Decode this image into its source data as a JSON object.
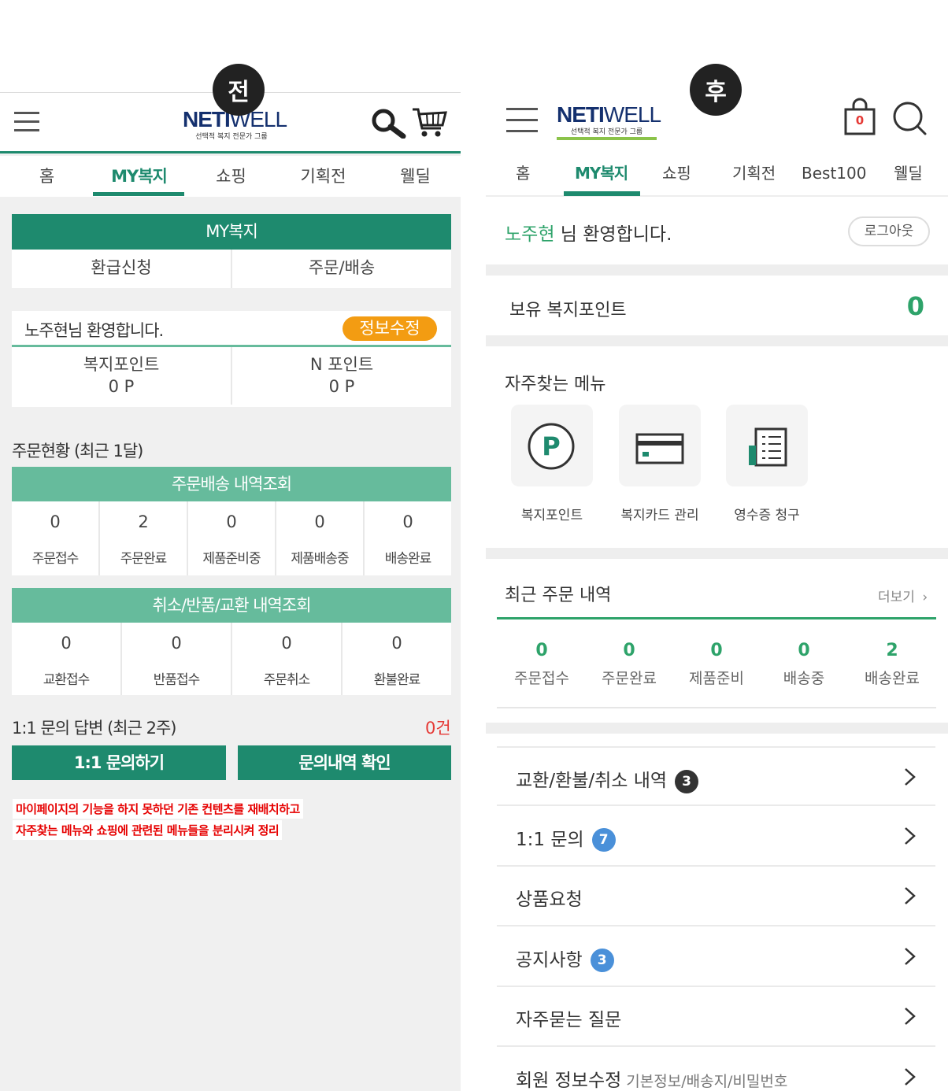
{
  "before": {
    "badge": "전",
    "logo": {
      "main": "NETIWELL",
      "sub": "선택적 복지 전문가 그룹"
    },
    "nav": [
      "홈",
      "MY복지",
      "쇼핑",
      "기획전",
      "웰딜"
    ],
    "my_header": "MY복지",
    "my_tabs": [
      "환급신청",
      "주문/배송"
    ],
    "welcome": "노주현님 환영합니다.",
    "edit_info": "정보수정",
    "points": [
      {
        "label": "복지포인트",
        "value": "0 P"
      },
      {
        "label": "N 포인트",
        "value": "0 P"
      }
    ],
    "order_title": "주문현황 (최근 1달)",
    "order_header": "주문배송 내역조회",
    "order_stats": [
      {
        "value": "0",
        "label": "주문접수"
      },
      {
        "value": "2",
        "label": "주문완료"
      },
      {
        "value": "0",
        "label": "제품준비중"
      },
      {
        "value": "0",
        "label": "제품배송중"
      },
      {
        "value": "0",
        "label": "배송완료"
      }
    ],
    "cancel_header": "취소/반품/교환 내역조회",
    "cancel_stats": [
      {
        "value": "0",
        "label": "교환접수"
      },
      {
        "value": "0",
        "label": "반품접수"
      },
      {
        "value": "0",
        "label": "주문취소"
      },
      {
        "value": "0",
        "label": "환불완료"
      }
    ],
    "qna_title": "1:1 문의 답변 (최근 2주)",
    "qna_count": "0건",
    "btn_inquiry": "1:1 문의하기",
    "btn_history": "문의내역 확인",
    "note_line1": "마이페이지의 기능을 하지 못하던 기존 컨텐츠를 재배치하고",
    "note_line2": "자주찾는 메뉴와 쇼핑에 관련된 메뉴들을 분리시켜 정리"
  },
  "after": {
    "badge": "후",
    "logo": {
      "main": "NETIWELL",
      "sub": "선택적 복지 전문가 그룹"
    },
    "cart_count": "0",
    "nav": [
      "홈",
      "MY복지",
      "쇼핑",
      "기획전",
      "Best100",
      "웰딜"
    ],
    "user_name": "노주현",
    "welcome_suffix": " 님 환영합니다.",
    "logout": "로그아웃",
    "points_label": "보유 복지포인트",
    "points_value": "0",
    "quick_title": "자주찾는 메뉴",
    "quick_menu": [
      {
        "label": "복지포인트",
        "icon": "point-icon"
      },
      {
        "label": "복지카드 관리",
        "icon": "card-icon"
      },
      {
        "label": "영수증 청구",
        "icon": "receipt-icon"
      }
    ],
    "recent_title": "최근 주문 내역",
    "more": "더보기",
    "order_stats": [
      {
        "value": "0",
        "label": "주문접수"
      },
      {
        "value": "0",
        "label": "주문완료"
      },
      {
        "value": "0",
        "label": "제품준비"
      },
      {
        "value": "0",
        "label": "배송중"
      },
      {
        "value": "2",
        "label": "배송완료"
      }
    ],
    "menu": [
      {
        "label": "교환/환불/취소 내역",
        "count": "3",
        "count_color": "#333333"
      },
      {
        "label": "1:1 문의",
        "count": "7",
        "count_color": "#4a90d9"
      },
      {
        "label": "상품요청",
        "count": "",
        "count_color": ""
      },
      {
        "label": "공지사항",
        "count": "3",
        "count_color": "#4a90d9"
      },
      {
        "label": "자주묻는 질문",
        "count": "",
        "count_color": ""
      },
      {
        "label": "회원 정보수정",
        "count": "",
        "count_color": "",
        "sub": "기본정보/배송지/비밀번호"
      }
    ]
  }
}
